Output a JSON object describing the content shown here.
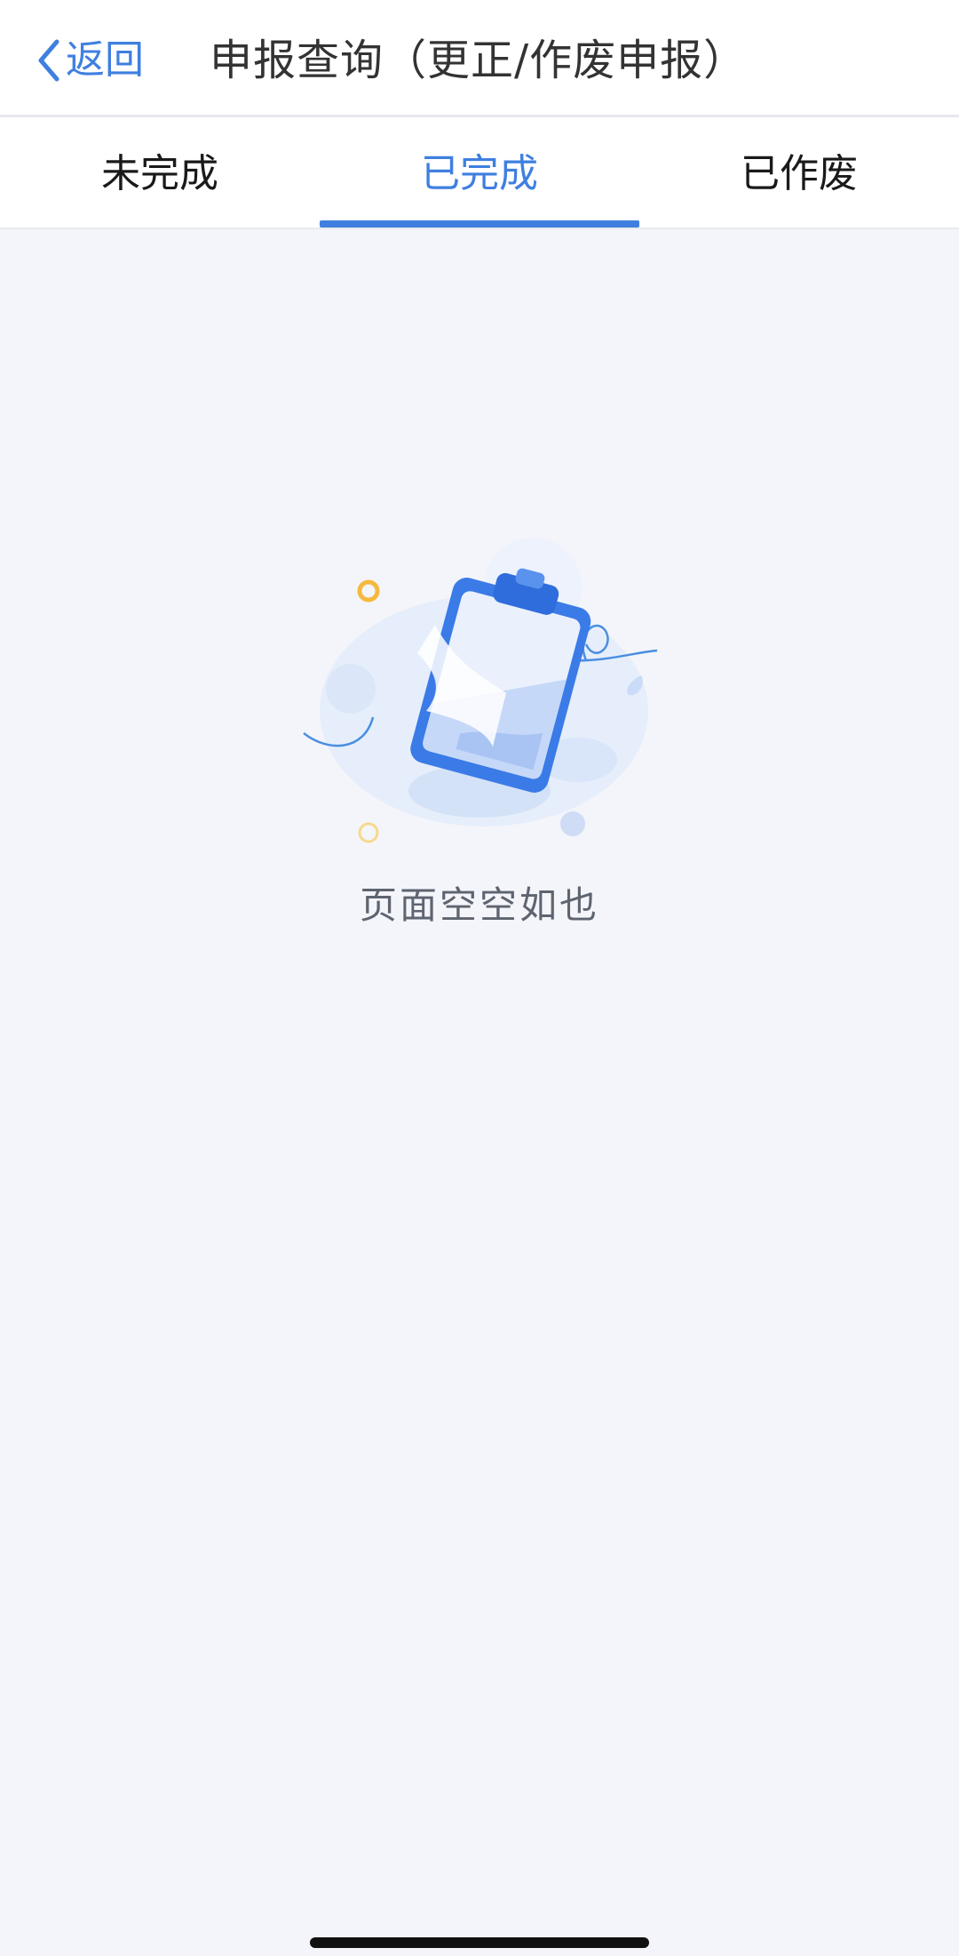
{
  "nav": {
    "back_label": "返回",
    "title": "申报查询（更正/作废申报）"
  },
  "tabs": [
    {
      "label": "未完成",
      "active": false
    },
    {
      "label": "已完成",
      "active": true
    },
    {
      "label": "已作废",
      "active": false
    }
  ],
  "empty_state": {
    "message": "页面空空如也",
    "icon": "empty-clipboard-icon"
  },
  "colors": {
    "accent": "#3f7fe0",
    "background": "#f3f5fa",
    "text_primary": "#1a1a1a",
    "text_secondary": "#5e6470"
  }
}
